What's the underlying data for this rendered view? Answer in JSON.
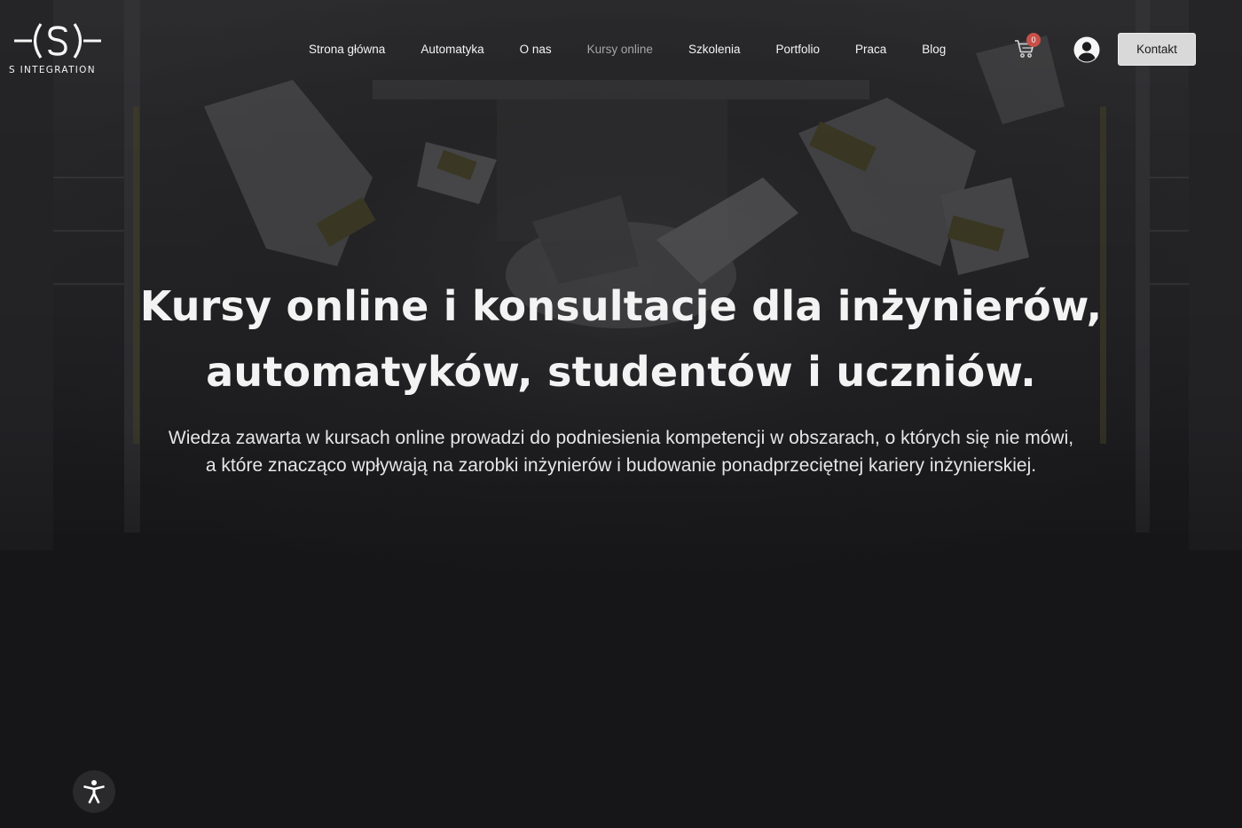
{
  "brand": {
    "logo_mark": "-(S)-",
    "name": "S INTEGRATION"
  },
  "nav": {
    "items": [
      {
        "label": "Strona główna",
        "active": false
      },
      {
        "label": "Automatyka",
        "active": false
      },
      {
        "label": "O nas",
        "active": false
      },
      {
        "label": "Kursy online",
        "active": true
      },
      {
        "label": "Szkolenia",
        "active": false
      },
      {
        "label": "Portfolio",
        "active": false
      },
      {
        "label": "Praca",
        "active": false
      },
      {
        "label": "Blog",
        "active": false
      }
    ]
  },
  "header": {
    "cart_icon": "shopping-cart-icon",
    "cart_count": "0",
    "account_icon": "user-circle-icon",
    "contact_label": "Kontakt"
  },
  "hero": {
    "title_line1": "Kursy online i konsultacje dla inżynierów,",
    "title_line2": "automatyków, studentów i uczniów.",
    "subtitle_line1": "Wiedza zawarta w kursach online prowadzi do podniesienia kompetencji w obszarach, o których się nie mówi,",
    "subtitle_line2": "a które znacząco wpływają na zarobki inżynierów i budowanie ponadprzeciętnej kariery inżynierskiej."
  },
  "accessibility": {
    "icon": "accessibility-icon"
  },
  "colors": {
    "background": "#161618",
    "text": "#f3f3f3",
    "nav_active": "#a6a6a8",
    "badge": "#c8504a",
    "button_bg": "#d9d9d9"
  }
}
